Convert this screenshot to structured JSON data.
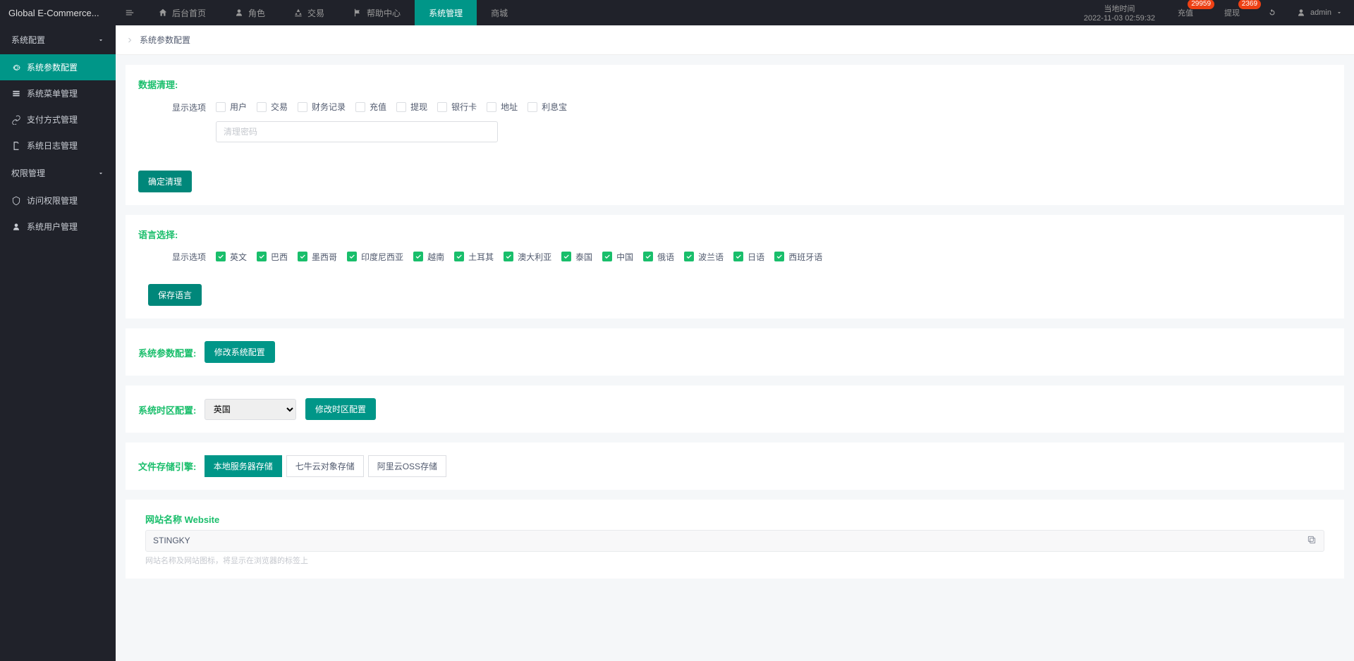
{
  "header": {
    "logo": "Global E-Commerce...",
    "nav": [
      {
        "label": "后台首页"
      },
      {
        "label": "角色"
      },
      {
        "label": "交易"
      },
      {
        "label": "帮助中心"
      },
      {
        "label": "系统管理",
        "active": true
      },
      {
        "label": "商城"
      }
    ],
    "time_label": "当地时间",
    "time_value": "2022-11-03 02:59:32",
    "recharge_label": "充值",
    "recharge_badge": "29959",
    "withdraw_label": "提现",
    "withdraw_badge": "2369",
    "user": "admin"
  },
  "sidebar": {
    "group1": "系统配置",
    "items1": [
      {
        "label": "系统参数配置",
        "active": true
      },
      {
        "label": "系统菜单管理"
      },
      {
        "label": "支付方式管理"
      },
      {
        "label": "系统日志管理"
      }
    ],
    "group2": "权限管理",
    "items2": [
      {
        "label": "访问权限管理"
      },
      {
        "label": "系统用户管理"
      }
    ]
  },
  "breadcrumb": "系统参数配置",
  "section1": {
    "title": "数据清理:",
    "row_label": "显示选项",
    "options": [
      "用户",
      "交易",
      "财务记录",
      "充值",
      "提现",
      "银行卡",
      "地址",
      "利息宝"
    ],
    "pwd_placeholder": "清理密码",
    "btn": "确定清理"
  },
  "section2": {
    "title": "语言选择:",
    "row_label": "显示选项",
    "options": [
      "英文",
      "巴西",
      "墨西哥",
      "印度尼西亚",
      "越南",
      "土耳其",
      "澳大利亚",
      "泰国",
      "中国",
      "俄语",
      "波兰语",
      "日语",
      "西班牙语"
    ],
    "btn": "保存语言"
  },
  "section3": {
    "title": "系统参数配置:",
    "btn": "修改系统配置"
  },
  "section4": {
    "title": "系统时区配置:",
    "selected": "英国",
    "btn": "修改时区配置"
  },
  "section5": {
    "title": "文件存储引擎:",
    "tabs": [
      "本地服务器存储",
      "七牛云对象存储",
      "阿里云OSS存储"
    ],
    "active_tab": 0
  },
  "section6": {
    "label": "网站名称 Website",
    "value": "STINGKY",
    "helper": "网站名称及网站图标，将显示在浏览器的标签上"
  }
}
